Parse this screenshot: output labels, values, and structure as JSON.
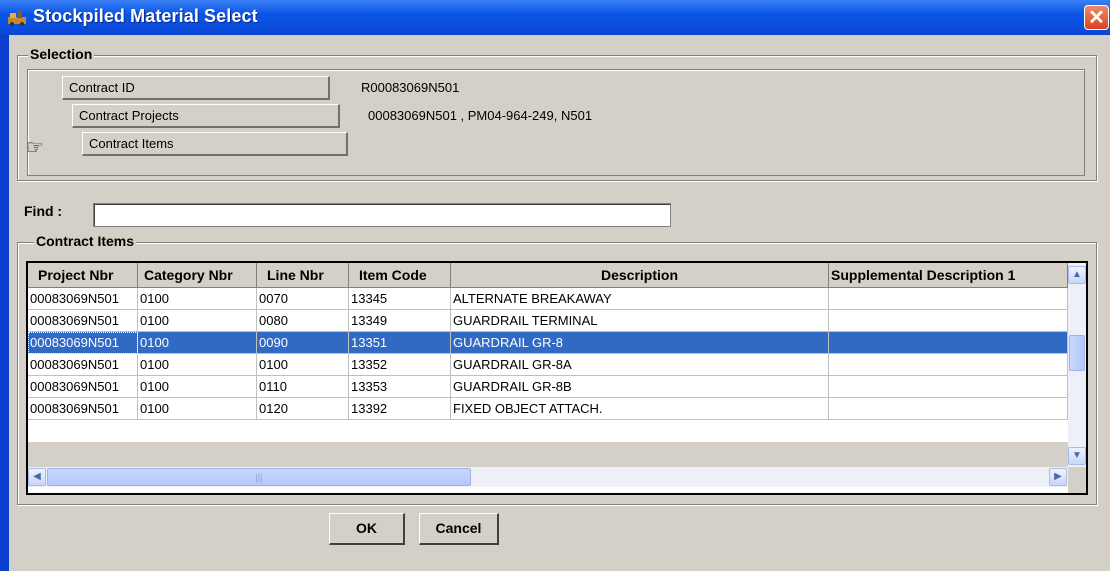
{
  "window": {
    "title": "Stockpiled Material Select",
    "icon": "app-icon",
    "close_icon": "close-icon",
    "close_glyph": "✕"
  },
  "selection": {
    "label": "Selection",
    "rows": [
      {
        "button": "Contract ID",
        "value": "R00083069N501"
      },
      {
        "button": "Contract Projects",
        "value": "00083069N501 , PM04-964-249, N501"
      },
      {
        "button": "Contract Items",
        "value": ""
      }
    ],
    "pointer_icon": "hand-pointer-icon"
  },
  "find": {
    "label": "Find :",
    "value": "",
    "placeholder": ""
  },
  "items": {
    "label": "Contract Items",
    "columns": [
      "Project Nbr",
      "Category Nbr",
      "Line Nbr",
      "Item Code",
      "Description",
      "Supplemental Description 1"
    ],
    "rows": [
      [
        "00083069N501",
        "0100",
        "0070",
        "13345",
        "ALTERNATE BREAKAWAY",
        ""
      ],
      [
        "00083069N501",
        "0100",
        "0080",
        "13349",
        "GUARDRAIL TERMINAL",
        ""
      ],
      [
        "00083069N501",
        "0100",
        "0090",
        "13351",
        "GUARDRAIL GR-8",
        ""
      ],
      [
        "00083069N501",
        "0100",
        "0100",
        "13352",
        "GUARDRAIL GR-8A",
        ""
      ],
      [
        "00083069N501",
        "0100",
        "0110",
        "13353",
        "GUARDRAIL GR-8B",
        ""
      ],
      [
        "00083069N501",
        "0100",
        "0120",
        "13392",
        "FIXED OBJECT ATTACH.",
        ""
      ]
    ],
    "selected_row": 2
  },
  "buttons": {
    "ok": "OK",
    "cancel": "Cancel"
  },
  "colors": {
    "selection": "#316ac5",
    "titlebar": "#0b55e6",
    "dialog": "#d4d0c8"
  }
}
